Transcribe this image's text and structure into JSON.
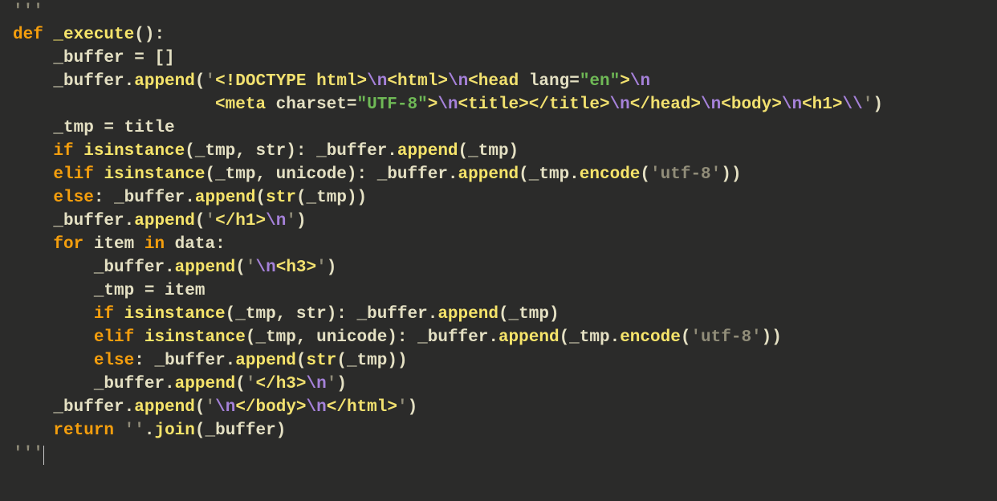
{
  "editor": {
    "language": "python",
    "theme": "dark",
    "font_family": "Menlo",
    "font_size_px": 21,
    "line_height_px": 29,
    "background": "#2b2b2a",
    "colors": {
      "keyword": "#f49e0d",
      "function": "#f6e46a",
      "identifier": "#e4e0c3",
      "string": "#918d79",
      "escape": "#a581d9",
      "tag": "#f2e16f",
      "attr_value": "#6fb956"
    }
  },
  "code": {
    "raw": "'''\ndef _execute():\n    _buffer = []\n    _buffer.append('<!DOCTYPE html>\\n<html>\\n<head lang=\"en\">\\n\n                    <meta charset=\"UTF-8\">\\n<title></title>\\n</head>\\n<body>\\n<h1>\\\\')\n    _tmp = title\n    if isinstance(_tmp, str): _buffer.append(_tmp)\n    elif isinstance(_tmp, unicode): _buffer.append(_tmp.encode('utf-8'))\n    else: _buffer.append(str(_tmp))\n    _buffer.append('</h1>\\n')\n    for item in data:\n        _buffer.append('\\n<h3>')\n        _tmp = item\n        if isinstance(_tmp, str): _buffer.append(_tmp)\n        elif isinstance(_tmp, unicode): _buffer.append(_tmp.encode('utf-8'))\n        else: _buffer.append(str(_tmp))\n        _buffer.append('</h3>\\n')\n    _buffer.append('\\n</body>\\n</html>')\n    return ''.join(_buffer)\n'''",
    "lines": [
      {
        "indent": 0,
        "tokens": [
          {
            "t": "str",
            "v": "'''"
          }
        ]
      },
      {
        "indent": 0,
        "tokens": [
          {
            "t": "kw",
            "v": "def "
          },
          {
            "t": "fn",
            "v": "_execute"
          },
          {
            "t": "pn",
            "v": "():"
          }
        ]
      },
      {
        "indent": 1,
        "tokens": [
          {
            "t": "id",
            "v": "_buffer = []"
          }
        ]
      },
      {
        "indent": 1,
        "tokens": [
          {
            "t": "id",
            "v": "_buffer."
          },
          {
            "t": "fn",
            "v": "append"
          },
          {
            "t": "pn",
            "v": "("
          },
          {
            "t": "str",
            "v": "'"
          },
          {
            "t": "tag",
            "v": "<!DOCTYPE html>"
          },
          {
            "t": "esc",
            "v": "\\n"
          },
          {
            "t": "tag",
            "v": "<html>"
          },
          {
            "t": "esc",
            "v": "\\n"
          },
          {
            "t": "tag",
            "v": "<head "
          },
          {
            "t": "attr",
            "v": "lang="
          },
          {
            "t": "val",
            "v": "\"en\""
          },
          {
            "t": "tag",
            "v": ">"
          },
          {
            "t": "esc",
            "v": "\\n"
          }
        ]
      },
      {
        "indent": 0,
        "tokens": [
          {
            "t": "str",
            "v": "                    "
          },
          {
            "t": "tag",
            "v": "<meta "
          },
          {
            "t": "attr",
            "v": "charset="
          },
          {
            "t": "val",
            "v": "\"UTF-8\""
          },
          {
            "t": "tag",
            "v": ">"
          },
          {
            "t": "esc",
            "v": "\\n"
          },
          {
            "t": "tag",
            "v": "<title></title>"
          },
          {
            "t": "esc",
            "v": "\\n"
          },
          {
            "t": "tag",
            "v": "</head>"
          },
          {
            "t": "esc",
            "v": "\\n"
          },
          {
            "t": "tag",
            "v": "<body>"
          },
          {
            "t": "esc",
            "v": "\\n"
          },
          {
            "t": "tag",
            "v": "<h1>"
          },
          {
            "t": "esc",
            "v": "\\\\"
          },
          {
            "t": "str",
            "v": "'"
          },
          {
            "t": "pn",
            "v": ")"
          }
        ]
      },
      {
        "indent": 1,
        "tokens": [
          {
            "t": "id",
            "v": "_tmp = title"
          }
        ]
      },
      {
        "indent": 1,
        "tokens": [
          {
            "t": "kw",
            "v": "if "
          },
          {
            "t": "fn",
            "v": "isinstance"
          },
          {
            "t": "pn",
            "v": "(_tmp, str): "
          },
          {
            "t": "id",
            "v": "_buffer."
          },
          {
            "t": "fn",
            "v": "append"
          },
          {
            "t": "pn",
            "v": "(_tmp)"
          }
        ]
      },
      {
        "indent": 1,
        "tokens": [
          {
            "t": "kw",
            "v": "elif "
          },
          {
            "t": "fn",
            "v": "isinstance"
          },
          {
            "t": "pn",
            "v": "(_tmp, unicode): "
          },
          {
            "t": "id",
            "v": "_buffer."
          },
          {
            "t": "fn",
            "v": "append"
          },
          {
            "t": "pn",
            "v": "(_tmp."
          },
          {
            "t": "fn",
            "v": "encode"
          },
          {
            "t": "pn",
            "v": "("
          },
          {
            "t": "str",
            "v": "'utf-8'"
          },
          {
            "t": "pn",
            "v": "))"
          }
        ]
      },
      {
        "indent": 1,
        "tokens": [
          {
            "t": "kw",
            "v": "else"
          },
          {
            "t": "pn",
            "v": ": "
          },
          {
            "t": "id",
            "v": "_buffer."
          },
          {
            "t": "fn",
            "v": "append"
          },
          {
            "t": "pn",
            "v": "("
          },
          {
            "t": "fn",
            "v": "str"
          },
          {
            "t": "pn",
            "v": "(_tmp))"
          }
        ]
      },
      {
        "indent": 1,
        "tokens": [
          {
            "t": "id",
            "v": "_buffer."
          },
          {
            "t": "fn",
            "v": "append"
          },
          {
            "t": "pn",
            "v": "("
          },
          {
            "t": "str",
            "v": "'"
          },
          {
            "t": "tag",
            "v": "</h1>"
          },
          {
            "t": "esc",
            "v": "\\n"
          },
          {
            "t": "str",
            "v": "'"
          },
          {
            "t": "pn",
            "v": ")"
          }
        ]
      },
      {
        "indent": 1,
        "tokens": [
          {
            "t": "kw",
            "v": "for "
          },
          {
            "t": "id",
            "v": "item "
          },
          {
            "t": "kw",
            "v": "in "
          },
          {
            "t": "id",
            "v": "data:"
          }
        ]
      },
      {
        "indent": 2,
        "tokens": [
          {
            "t": "id",
            "v": "_buffer."
          },
          {
            "t": "fn",
            "v": "append"
          },
          {
            "t": "pn",
            "v": "("
          },
          {
            "t": "str",
            "v": "'"
          },
          {
            "t": "esc",
            "v": "\\n"
          },
          {
            "t": "tag",
            "v": "<h3>"
          },
          {
            "t": "str",
            "v": "'"
          },
          {
            "t": "pn",
            "v": ")"
          }
        ]
      },
      {
        "indent": 2,
        "tokens": [
          {
            "t": "id",
            "v": "_tmp = item"
          }
        ]
      },
      {
        "indent": 2,
        "tokens": [
          {
            "t": "kw",
            "v": "if "
          },
          {
            "t": "fn",
            "v": "isinstance"
          },
          {
            "t": "pn",
            "v": "(_tmp, str): "
          },
          {
            "t": "id",
            "v": "_buffer."
          },
          {
            "t": "fn",
            "v": "append"
          },
          {
            "t": "pn",
            "v": "(_tmp)"
          }
        ]
      },
      {
        "indent": 2,
        "tokens": [
          {
            "t": "kw",
            "v": "elif "
          },
          {
            "t": "fn",
            "v": "isinstance"
          },
          {
            "t": "pn",
            "v": "(_tmp, unicode): "
          },
          {
            "t": "id",
            "v": "_buffer."
          },
          {
            "t": "fn",
            "v": "append"
          },
          {
            "t": "pn",
            "v": "(_tmp."
          },
          {
            "t": "fn",
            "v": "encode"
          },
          {
            "t": "pn",
            "v": "("
          },
          {
            "t": "str",
            "v": "'utf-8'"
          },
          {
            "t": "pn",
            "v": "))"
          }
        ]
      },
      {
        "indent": 2,
        "tokens": [
          {
            "t": "kw",
            "v": "else"
          },
          {
            "t": "pn",
            "v": ": "
          },
          {
            "t": "id",
            "v": "_buffer."
          },
          {
            "t": "fn",
            "v": "append"
          },
          {
            "t": "pn",
            "v": "("
          },
          {
            "t": "fn",
            "v": "str"
          },
          {
            "t": "pn",
            "v": "(_tmp))"
          }
        ]
      },
      {
        "indent": 2,
        "tokens": [
          {
            "t": "id",
            "v": "_buffer."
          },
          {
            "t": "fn",
            "v": "append"
          },
          {
            "t": "pn",
            "v": "("
          },
          {
            "t": "str",
            "v": "'"
          },
          {
            "t": "tag",
            "v": "</h3>"
          },
          {
            "t": "esc",
            "v": "\\n"
          },
          {
            "t": "str",
            "v": "'"
          },
          {
            "t": "pn",
            "v": ")"
          }
        ]
      },
      {
        "indent": 1,
        "tokens": [
          {
            "t": "id",
            "v": "_buffer."
          },
          {
            "t": "fn",
            "v": "append"
          },
          {
            "t": "pn",
            "v": "("
          },
          {
            "t": "str",
            "v": "'"
          },
          {
            "t": "esc",
            "v": "\\n"
          },
          {
            "t": "tag",
            "v": "</body>"
          },
          {
            "t": "esc",
            "v": "\\n"
          },
          {
            "t": "tag",
            "v": "</html>"
          },
          {
            "t": "str",
            "v": "'"
          },
          {
            "t": "pn",
            "v": ")"
          }
        ]
      },
      {
        "indent": 1,
        "tokens": [
          {
            "t": "kw",
            "v": "return "
          },
          {
            "t": "str",
            "v": "''"
          },
          {
            "t": "pn",
            "v": "."
          },
          {
            "t": "fn",
            "v": "join"
          },
          {
            "t": "pn",
            "v": "(_buffer)"
          }
        ]
      },
      {
        "indent": 0,
        "tokens": [
          {
            "t": "str",
            "v": "'''"
          }
        ],
        "cursor_after": true
      }
    ]
  }
}
